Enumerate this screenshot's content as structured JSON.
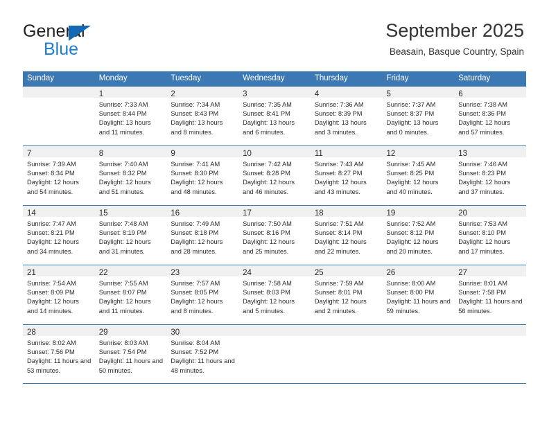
{
  "logo": {
    "word_top": "General",
    "word_bottom": "Blue",
    "triangle_color": "#1268b3",
    "blue_color": "#1c7fd4"
  },
  "header": {
    "title": "September 2025",
    "subtitle": "Beasain, Basque Country, Spain"
  },
  "theme": {
    "header_blue": "#3c78b4",
    "day_band_gray": "#f0f0f0",
    "text": "#2b2b2b"
  },
  "calendar": {
    "weekday_headers": [
      "Sunday",
      "Monday",
      "Tuesday",
      "Wednesday",
      "Thursday",
      "Friday",
      "Saturday"
    ],
    "weeks": [
      [
        {
          "day": "",
          "empty": true
        },
        {
          "day": "1",
          "sunrise": "Sunrise: 7:33 AM",
          "sunset": "Sunset: 8:44 PM",
          "daylight": "Daylight: 13 hours and 11 minutes."
        },
        {
          "day": "2",
          "sunrise": "Sunrise: 7:34 AM",
          "sunset": "Sunset: 8:43 PM",
          "daylight": "Daylight: 13 hours and 8 minutes."
        },
        {
          "day": "3",
          "sunrise": "Sunrise: 7:35 AM",
          "sunset": "Sunset: 8:41 PM",
          "daylight": "Daylight: 13 hours and 6 minutes."
        },
        {
          "day": "4",
          "sunrise": "Sunrise: 7:36 AM",
          "sunset": "Sunset: 8:39 PM",
          "daylight": "Daylight: 13 hours and 3 minutes."
        },
        {
          "day": "5",
          "sunrise": "Sunrise: 7:37 AM",
          "sunset": "Sunset: 8:37 PM",
          "daylight": "Daylight: 13 hours and 0 minutes."
        },
        {
          "day": "6",
          "sunrise": "Sunrise: 7:38 AM",
          "sunset": "Sunset: 8:36 PM",
          "daylight": "Daylight: 12 hours and 57 minutes."
        }
      ],
      [
        {
          "day": "7",
          "sunrise": "Sunrise: 7:39 AM",
          "sunset": "Sunset: 8:34 PM",
          "daylight": "Daylight: 12 hours and 54 minutes."
        },
        {
          "day": "8",
          "sunrise": "Sunrise: 7:40 AM",
          "sunset": "Sunset: 8:32 PM",
          "daylight": "Daylight: 12 hours and 51 minutes."
        },
        {
          "day": "9",
          "sunrise": "Sunrise: 7:41 AM",
          "sunset": "Sunset: 8:30 PM",
          "daylight": "Daylight: 12 hours and 48 minutes."
        },
        {
          "day": "10",
          "sunrise": "Sunrise: 7:42 AM",
          "sunset": "Sunset: 8:28 PM",
          "daylight": "Daylight: 12 hours and 46 minutes."
        },
        {
          "day": "11",
          "sunrise": "Sunrise: 7:43 AM",
          "sunset": "Sunset: 8:27 PM",
          "daylight": "Daylight: 12 hours and 43 minutes."
        },
        {
          "day": "12",
          "sunrise": "Sunrise: 7:45 AM",
          "sunset": "Sunset: 8:25 PM",
          "daylight": "Daylight: 12 hours and 40 minutes."
        },
        {
          "day": "13",
          "sunrise": "Sunrise: 7:46 AM",
          "sunset": "Sunset: 8:23 PM",
          "daylight": "Daylight: 12 hours and 37 minutes."
        }
      ],
      [
        {
          "day": "14",
          "sunrise": "Sunrise: 7:47 AM",
          "sunset": "Sunset: 8:21 PM",
          "daylight": "Daylight: 12 hours and 34 minutes."
        },
        {
          "day": "15",
          "sunrise": "Sunrise: 7:48 AM",
          "sunset": "Sunset: 8:19 PM",
          "daylight": "Daylight: 12 hours and 31 minutes."
        },
        {
          "day": "16",
          "sunrise": "Sunrise: 7:49 AM",
          "sunset": "Sunset: 8:18 PM",
          "daylight": "Daylight: 12 hours and 28 minutes."
        },
        {
          "day": "17",
          "sunrise": "Sunrise: 7:50 AM",
          "sunset": "Sunset: 8:16 PM",
          "daylight": "Daylight: 12 hours and 25 minutes."
        },
        {
          "day": "18",
          "sunrise": "Sunrise: 7:51 AM",
          "sunset": "Sunset: 8:14 PM",
          "daylight": "Daylight: 12 hours and 22 minutes."
        },
        {
          "day": "19",
          "sunrise": "Sunrise: 7:52 AM",
          "sunset": "Sunset: 8:12 PM",
          "daylight": "Daylight: 12 hours and 20 minutes."
        },
        {
          "day": "20",
          "sunrise": "Sunrise: 7:53 AM",
          "sunset": "Sunset: 8:10 PM",
          "daylight": "Daylight: 12 hours and 17 minutes."
        }
      ],
      [
        {
          "day": "21",
          "sunrise": "Sunrise: 7:54 AM",
          "sunset": "Sunset: 8:09 PM",
          "daylight": "Daylight: 12 hours and 14 minutes."
        },
        {
          "day": "22",
          "sunrise": "Sunrise: 7:55 AM",
          "sunset": "Sunset: 8:07 PM",
          "daylight": "Daylight: 12 hours and 11 minutes."
        },
        {
          "day": "23",
          "sunrise": "Sunrise: 7:57 AM",
          "sunset": "Sunset: 8:05 PM",
          "daylight": "Daylight: 12 hours and 8 minutes."
        },
        {
          "day": "24",
          "sunrise": "Sunrise: 7:58 AM",
          "sunset": "Sunset: 8:03 PM",
          "daylight": "Daylight: 12 hours and 5 minutes."
        },
        {
          "day": "25",
          "sunrise": "Sunrise: 7:59 AM",
          "sunset": "Sunset: 8:01 PM",
          "daylight": "Daylight: 12 hours and 2 minutes."
        },
        {
          "day": "26",
          "sunrise": "Sunrise: 8:00 AM",
          "sunset": "Sunset: 8:00 PM",
          "daylight": "Daylight: 11 hours and 59 minutes."
        },
        {
          "day": "27",
          "sunrise": "Sunrise: 8:01 AM",
          "sunset": "Sunset: 7:58 PM",
          "daylight": "Daylight: 11 hours and 56 minutes."
        }
      ],
      [
        {
          "day": "28",
          "sunrise": "Sunrise: 8:02 AM",
          "sunset": "Sunset: 7:56 PM",
          "daylight": "Daylight: 11 hours and 53 minutes."
        },
        {
          "day": "29",
          "sunrise": "Sunrise: 8:03 AM",
          "sunset": "Sunset: 7:54 PM",
          "daylight": "Daylight: 11 hours and 50 minutes."
        },
        {
          "day": "30",
          "sunrise": "Sunrise: 8:04 AM",
          "sunset": "Sunset: 7:52 PM",
          "daylight": "Daylight: 11 hours and 48 minutes."
        },
        {
          "day": "",
          "empty": true
        },
        {
          "day": "",
          "empty": true
        },
        {
          "day": "",
          "empty": true
        },
        {
          "day": "",
          "empty": true
        }
      ]
    ]
  }
}
